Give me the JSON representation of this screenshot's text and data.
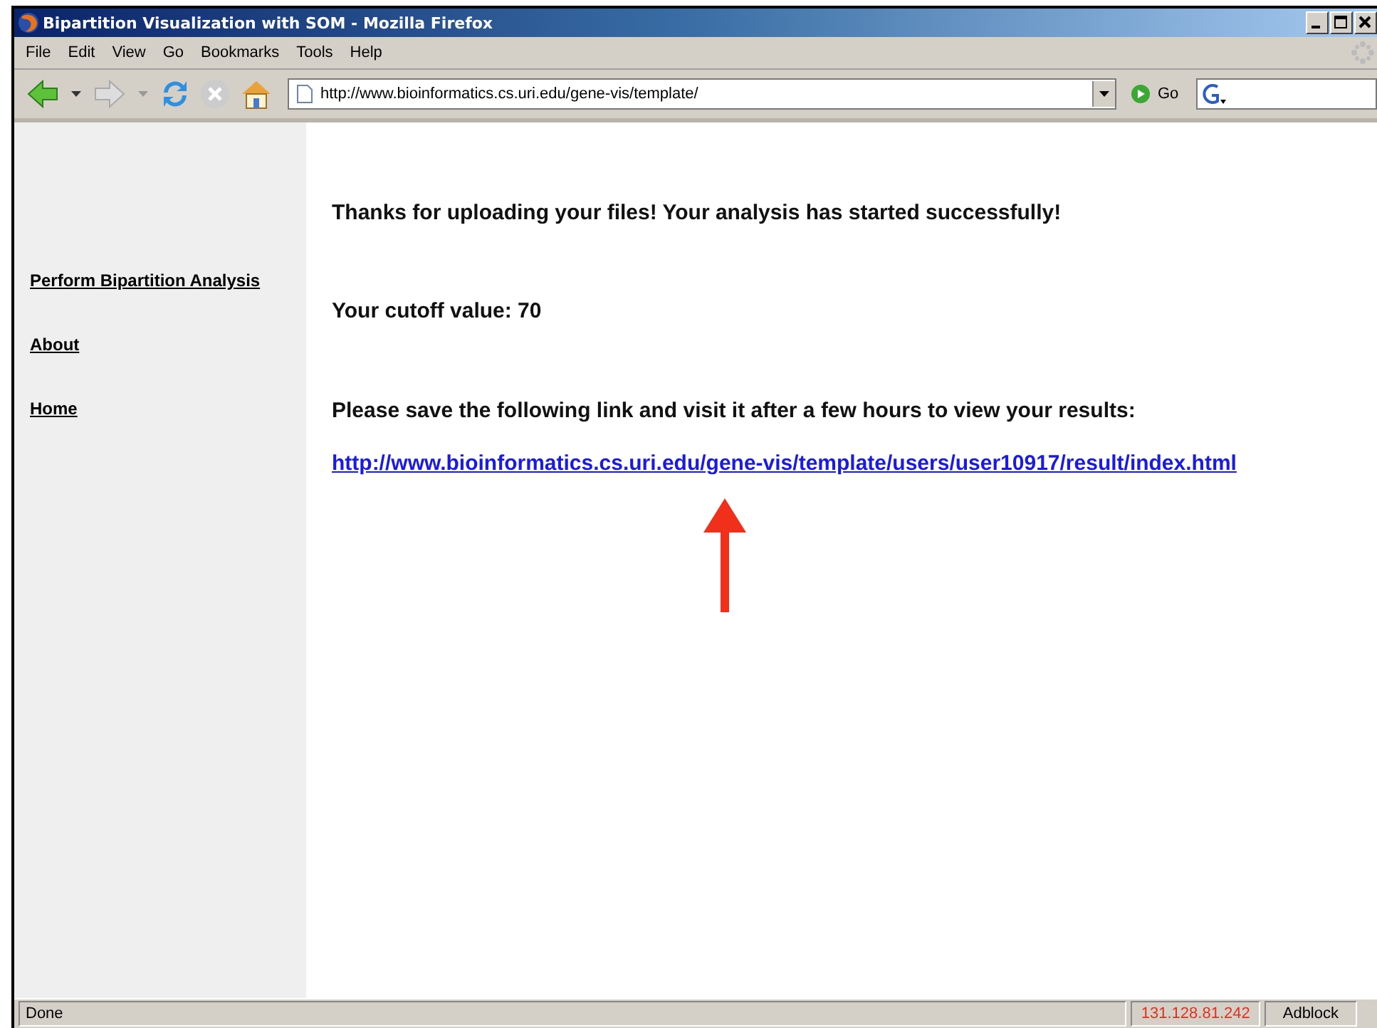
{
  "window": {
    "title": "Bipartition Visualization with SOM - Mozilla Firefox"
  },
  "menu": [
    "File",
    "Edit",
    "View",
    "Go",
    "Bookmarks",
    "Tools",
    "Help"
  ],
  "toolbar": {
    "address": "http://www.bioinformatics.cs.uri.edu/gene-vis/template/",
    "go": "Go"
  },
  "sidebar": {
    "items": [
      {
        "label": "Perform Bipartition Analysis"
      },
      {
        "label": "About"
      },
      {
        "label": "Home"
      }
    ]
  },
  "content": {
    "message": "Thanks for uploading your files! Your analysis has started successfully!",
    "cutoff": "Your cutoff value: 70",
    "instruction": "Please save the following link and visit it after a few hours to view your results:",
    "link": "http://www.bioinformatics.cs.uri.edu/gene-vis/template/users/user10917/result/index.html"
  },
  "status_bar": {
    "text": "Done",
    "ip": "131.128.81.242",
    "addon": "Adblock"
  }
}
